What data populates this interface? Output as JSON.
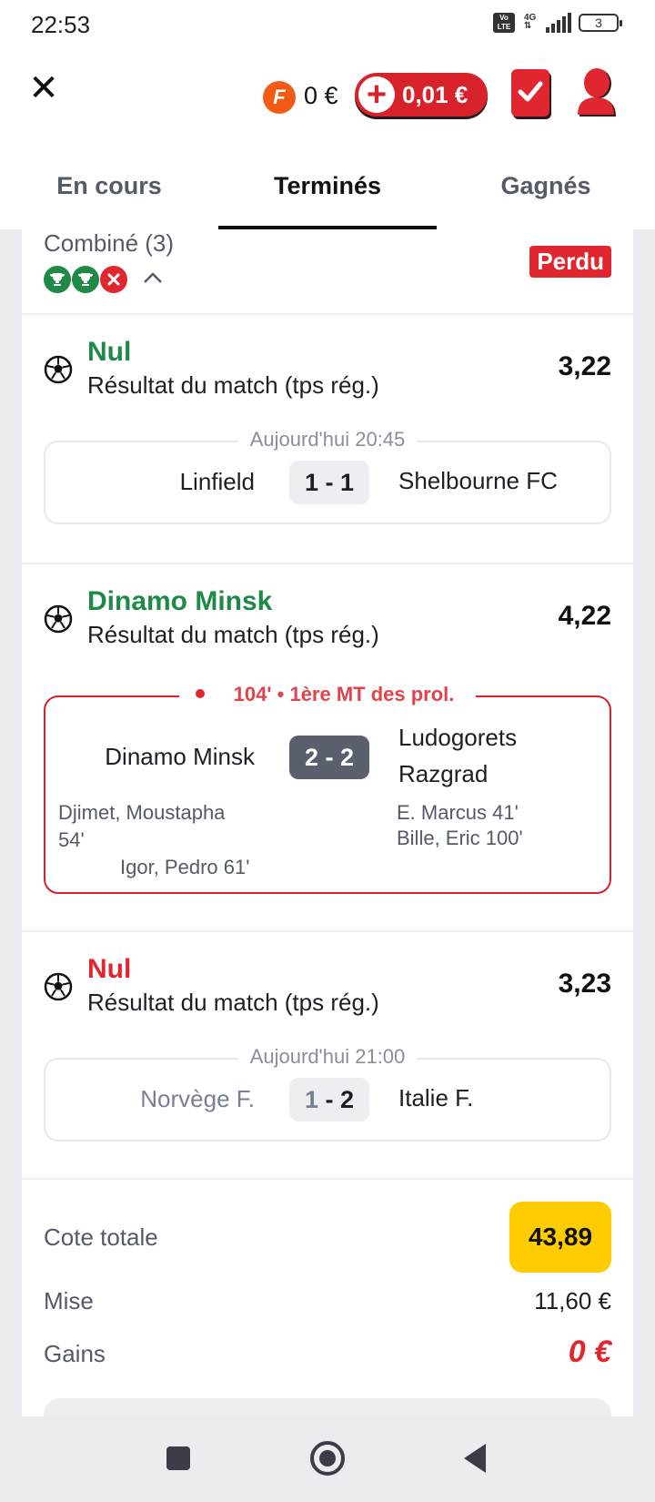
{
  "status_bar": {
    "time": "22:53",
    "volte_label": "Vo LTE",
    "network": "4G",
    "battery": "3"
  },
  "header": {
    "close_icon": "close-icon",
    "freebet_coin_letter": "F",
    "freebet_balance": "0 €",
    "balance": "0,01 €",
    "accent_color": "#d8222b"
  },
  "tabs": [
    {
      "label": "En cours",
      "active": false
    },
    {
      "label": "Terminés",
      "active": true
    },
    {
      "label": "Gagnés",
      "active": false
    }
  ],
  "bet": {
    "title": "Combiné (3)",
    "status": "Perdu",
    "leg_results": [
      "win",
      "win",
      "lose"
    ],
    "selections": [
      {
        "pick": "Nul",
        "pick_color": "green",
        "market": "Résultat du match (tps rég.)",
        "odds": "3,22",
        "match": {
          "time": "Aujourd'hui 20:45",
          "home": "Linfield",
          "away": "Shelbourne FC",
          "score": "1 - 1"
        }
      },
      {
        "pick": "Dinamo Minsk",
        "pick_color": "green",
        "market": "Résultat du match (tps rég.)",
        "odds": "4,22",
        "match": {
          "time": "104' • 1ère MT des prol.",
          "home": "Dinamo Minsk",
          "away_line1": "Ludogorets",
          "away_line2": "Razgrad",
          "score": "2 - 2",
          "home_scorers": [
            "Djimet, Moustapha",
            "54'",
            "Igor, Pedro 61'"
          ],
          "away_scorers": [
            "E. Marcus 41'",
            "Bille, Eric 100'"
          ]
        }
      },
      {
        "pick": "Nul",
        "pick_color": "red",
        "market": "Résultat du match (tps rég.)",
        "odds": "3,23",
        "match": {
          "time": "Aujourd'hui 21:00",
          "home": "Norvège F.",
          "away": "Italie F.",
          "score_home": "1",
          "score_sep": " - ",
          "score_away": "2"
        }
      }
    ],
    "summary": {
      "total_odds_label": "Cote totale",
      "total_odds": "43,89",
      "stake_label": "Mise",
      "stake": "11,60 €",
      "winnings_label": "Gains",
      "winnings": "0 €"
    }
  },
  "nav": [
    "recents-icon",
    "home-icon",
    "back-icon"
  ]
}
